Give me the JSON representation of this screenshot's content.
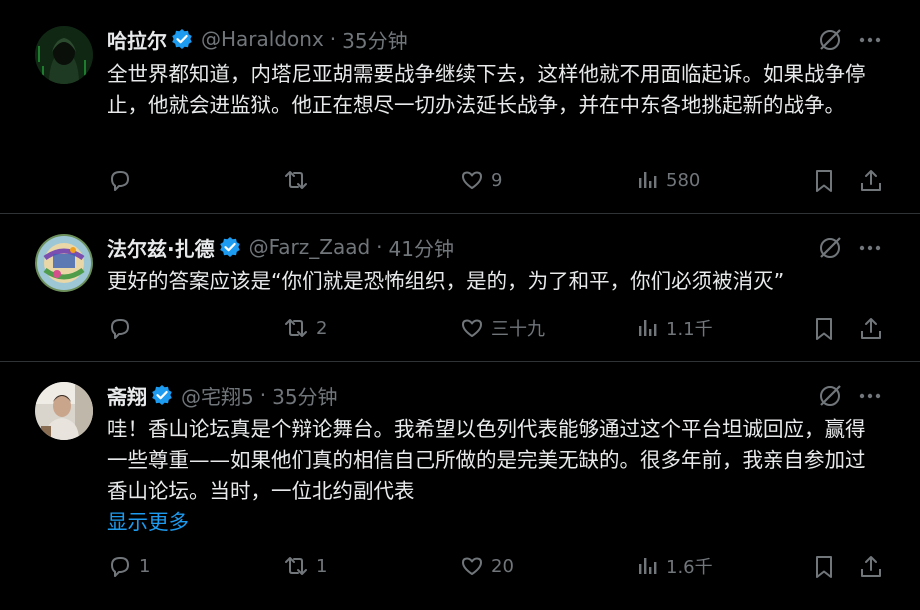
{
  "tweets": [
    {
      "name": "哈拉尔",
      "handle": "@Haraldonx",
      "dot": "·",
      "time": "35分钟",
      "text": "全世界都知道，内塔尼亚胡需要战争继续下去，这样他就不用面临起诉。如果战争停止，他就会进监狱。他正在想尽一切办法延长战争，并在中东各地挑起新的战争。",
      "replies": "",
      "reposts": "",
      "likes": "9",
      "views": "580"
    },
    {
      "name": "法尔兹·扎德",
      "handle": "@Farz_Zaad",
      "dot": "·",
      "time": "41分钟",
      "text": "更好的答案应该是“你们就是恐怖组织，是的，为了和平，你们必须被消灭”",
      "replies": "",
      "reposts": "2",
      "likes": "三十九",
      "views": "1.1千"
    },
    {
      "name": "斋翔",
      "handle": "@宅翔5",
      "dot": "·",
      "time": "35分钟",
      "text": "哇！香山论坛真是个辩论舞台。我希望以色列代表能够通过这个平台坦诚回应，赢得一些尊重——如果他们真的相信自己所做的是完美无缺的。很多年前，我亲自参加过香山论坛。当时，一位北约副代表",
      "show_more": "显示更多",
      "replies": "1",
      "reposts": "1",
      "likes": "20",
      "views": "1.6千"
    }
  ],
  "colors": {
    "background": "#000000",
    "text": "#e7e9ea",
    "muted": "#71767b",
    "accent": "#1d9bf0",
    "divider": "#2f3336"
  }
}
